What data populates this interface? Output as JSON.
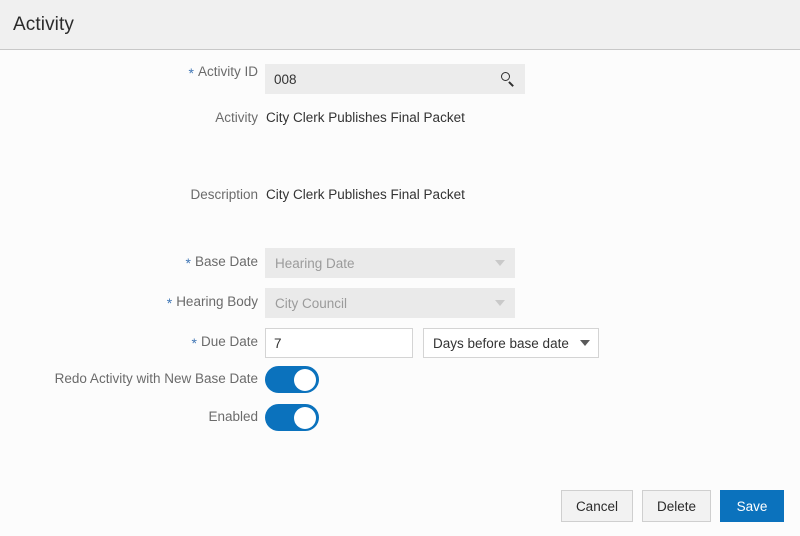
{
  "header": {
    "title": "Activity"
  },
  "form": {
    "activity_id": {
      "label": "Activity ID",
      "required": true,
      "value": "008",
      "icon": "search-icon"
    },
    "activity": {
      "label": "Activity",
      "required": false,
      "value": "City Clerk Publishes Final Packet"
    },
    "description": {
      "label": "Description",
      "required": false,
      "value": "City Clerk Publishes Final Packet"
    },
    "base_date": {
      "label": "Base Date",
      "required": true,
      "value": "Hearing Date",
      "disabled": true
    },
    "hearing_body": {
      "label": "Hearing Body",
      "required": true,
      "value": "City Council",
      "disabled": true
    },
    "due_date": {
      "label": "Due Date",
      "required": true,
      "value": "7",
      "offset_value": "Days before base date"
    },
    "redo_activity": {
      "label": "Redo Activity with New Base Date",
      "state": "on"
    },
    "enabled": {
      "label": "Enabled",
      "state": "on"
    },
    "required_marker": "*"
  },
  "footer": {
    "cancel_label": "Cancel",
    "delete_label": "Delete",
    "save_label": "Save"
  },
  "colors": {
    "accent": "#0b72bd",
    "header_bg": "#f0f0f0",
    "body_bg": "#fcfcfc",
    "label": "#6b6b6b",
    "required_asterisk": "#3f76b5",
    "disabled_field_bg": "#eaeaea"
  }
}
